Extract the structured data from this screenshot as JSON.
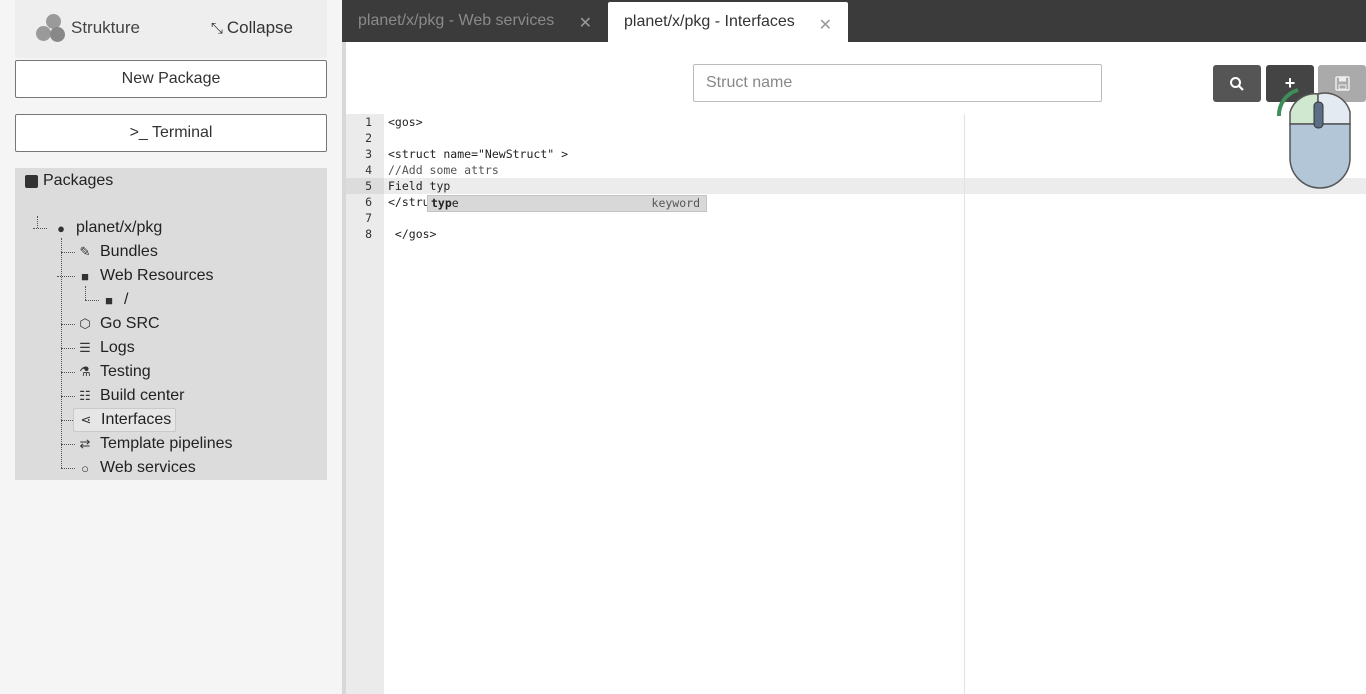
{
  "sidebar": {
    "brand": "Strukture",
    "collapse_label": "Collapse",
    "new_package": "New Package",
    "terminal": ">_ Terminal",
    "packages_header": "Packages",
    "root": "planet/x/pkg",
    "items": [
      {
        "label": "Bundles",
        "icon": "edit-icon"
      },
      {
        "label": "Web Resources",
        "icon": "folder-icon"
      },
      {
        "label": "/",
        "icon": "folder-icon"
      },
      {
        "label": "Go SRC",
        "icon": "cube-icon"
      },
      {
        "label": "Logs",
        "icon": "list-icon"
      },
      {
        "label": "Testing",
        "icon": "flask-icon"
      },
      {
        "label": "Build center",
        "icon": "server-icon"
      },
      {
        "label": "Interfaces",
        "icon": "share-icon"
      },
      {
        "label": "Template pipelines",
        "icon": "exchange-icon"
      },
      {
        "label": "Web services",
        "icon": "circle-icon"
      }
    ],
    "selected": "Interfaces"
  },
  "tabs": [
    {
      "label": "planet/x/pkg - Web services",
      "active": false
    },
    {
      "label": "planet/x/pkg - Interfaces",
      "active": true
    }
  ],
  "toolbar": {
    "search_placeholder": "Struct name",
    "search_value": ""
  },
  "editor": {
    "line_numbers": [
      "1",
      "2",
      "3",
      "4",
      "5",
      "6",
      "7",
      "8"
    ],
    "lines": [
      "<gos>",
      "",
      "<struct name=\"NewStruct\" >",
      "//Add some attrs",
      "Field typ",
      "</stru",
      "",
      " </gos>"
    ],
    "active_line": 5,
    "autocomplete": {
      "match": "typ",
      "rest": "e",
      "meta": "keyword"
    }
  },
  "colors": {
    "tabbar": "#3b3b3b",
    "sidebar_panel": "#dcdcdc",
    "button_dark": "#555555"
  }
}
